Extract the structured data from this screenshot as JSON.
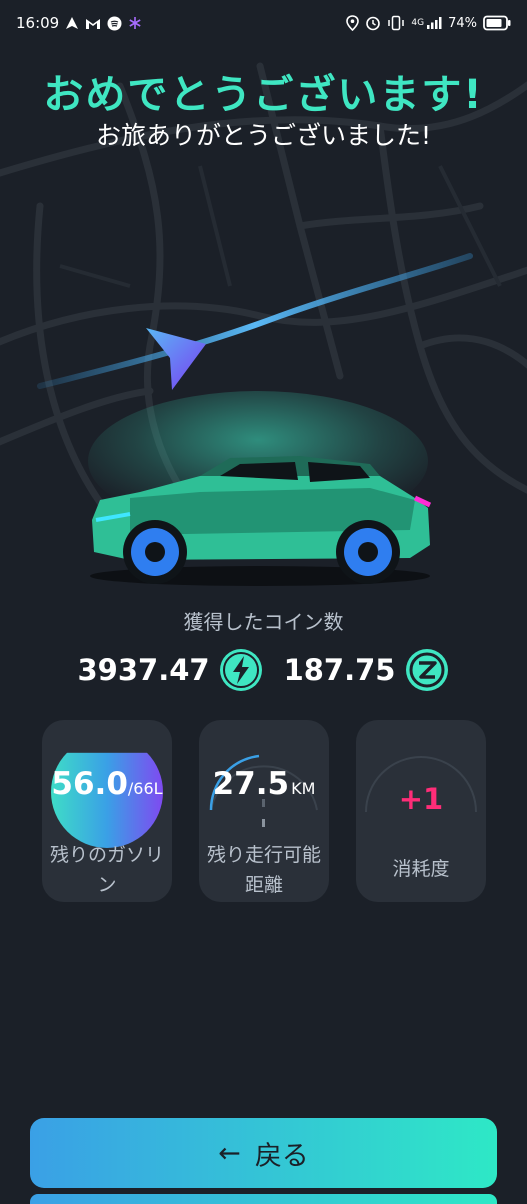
{
  "status_bar": {
    "time": "16:09",
    "network": "4G",
    "battery": "74%"
  },
  "header": {
    "title": "おめでとうございます!",
    "subtitle": "お旅ありがとうございました!"
  },
  "coins": {
    "label": "獲得したコイン数",
    "energy_value": "3937.47",
    "z_value": "187.75"
  },
  "cards": {
    "gasoline": {
      "value": "56.0",
      "capacity": "/66L",
      "label_line1": "残りのガソリ",
      "label_line2": "ン",
      "level": 0.85
    },
    "range": {
      "value": "27.5",
      "unit": "KM",
      "label_line1": "残り走行可能",
      "label_line2": "距離"
    },
    "consumption": {
      "value": "+1",
      "label": "消耗度"
    }
  },
  "back_button": {
    "arrow": "←",
    "label": "戻る"
  },
  "colors": {
    "accent": "#3fe6c2",
    "pink": "#ff2d78",
    "gauge_blue": "#3aa0e6",
    "background": "#1b2028",
    "card": "#2a3039"
  },
  "icons": [
    "navigation-icon",
    "gmail-icon",
    "spotify-icon",
    "asterisk-icon",
    "location-icon",
    "alarm-icon",
    "vibrate-icon",
    "signal-icon",
    "battery-icon",
    "lightning-coin-icon",
    "z-coin-icon",
    "arrow-left-icon"
  ]
}
